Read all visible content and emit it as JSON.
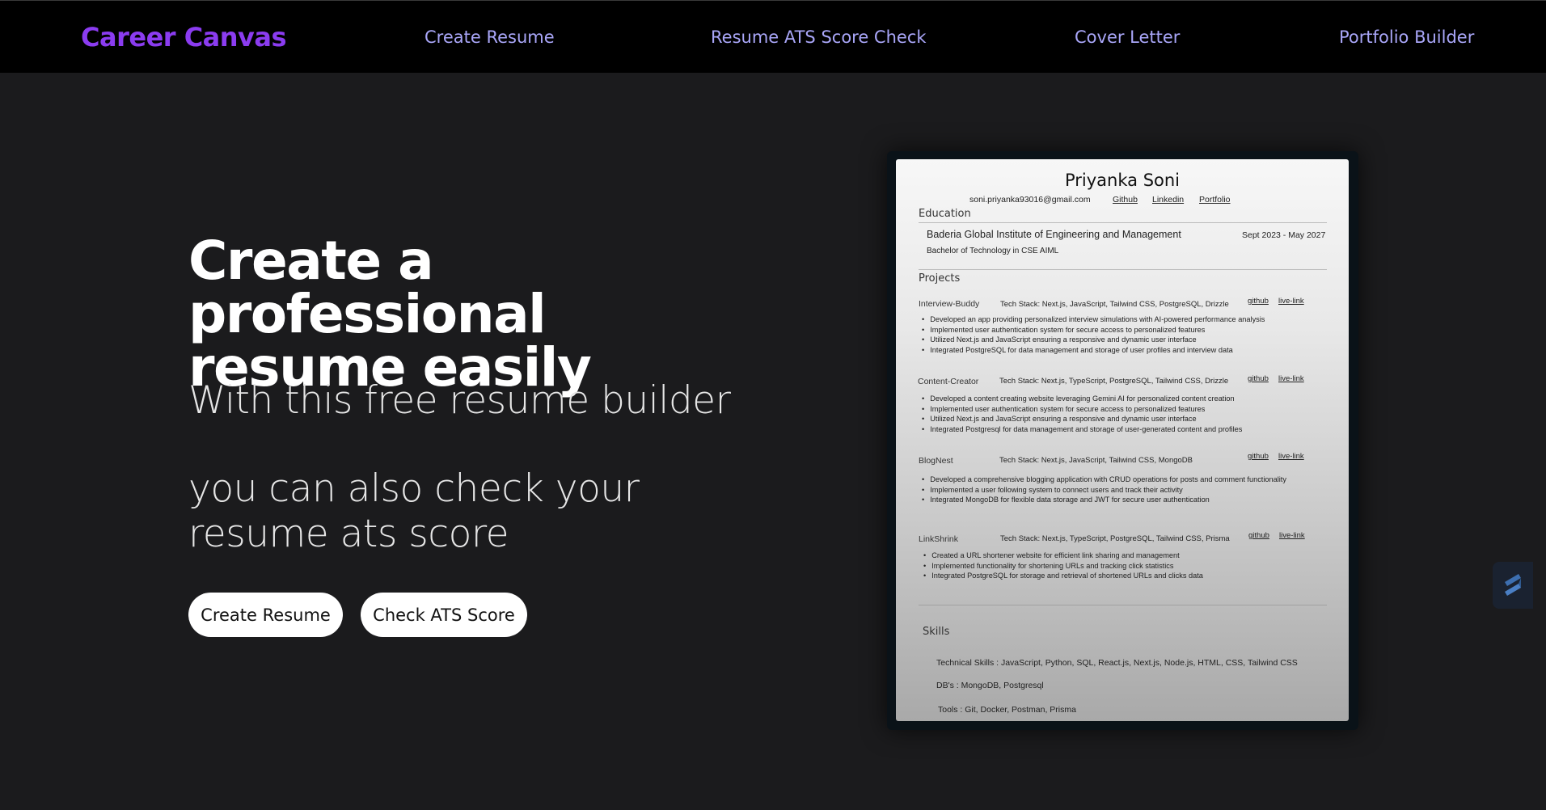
{
  "nav": {
    "brand": "Career Canvas",
    "links": [
      "Create Resume",
      "Resume ATS Score Check",
      "Cover Letter",
      "Portfolio Builder"
    ]
  },
  "hero": {
    "title": "Create a professional resume easily",
    "subtitle": "With this free resume builder",
    "ats_text": "you can also check your resume ats score",
    "buttons": [
      "Create Resume",
      "Check ATS Score"
    ]
  },
  "resume": {
    "name": "Priyanka Soni",
    "email": "soni.priyanka93016@gmail.com",
    "contact_links": [
      "Github",
      "Linkedin",
      "Portfolio"
    ],
    "education_heading": "Education",
    "institute": "Baderia Global Institute of Engineering and Management",
    "dates": "Sept 2023 - May 2027",
    "degree": "Bachelor of Technology in CSE AIML",
    "projects_heading": "Projects",
    "projects": [
      {
        "name": "Interview-Buddy",
        "stack": "Tech Stack: Next.js, JavaScript, Tailwind CSS, PostgreSQL, Drizzle",
        "links": [
          "github",
          "live-link"
        ],
        "bullets": [
          "Developed an app providing personalized interview simulations with AI-powered performance analysis",
          "Implemented user authentication system for secure access to personalized features",
          "Utilized Next.js and JavaScript ensuring a responsive and dynamic user interface",
          "Integrated PostgreSQL for data management and storage of user profiles and interview data"
        ]
      },
      {
        "name": "Content-Creator",
        "stack": "Tech Stack: Next.js, TypeScript, PostgreSQL, Tailwind CSS, Drizzle",
        "links": [
          "github",
          "live-link"
        ],
        "bullets": [
          "Developed a content creating website leveraging Gemini AI for personalized content creation",
          "Implemented user authentication system for secure access to personalized features",
          "Utilized Next.js and JavaScript ensuring a responsive and dynamic user interface",
          "Integrated Postgresql for data management and storage of user-generated content and profiles"
        ]
      },
      {
        "name": "BlogNest",
        "stack": "Tech Stack: Next.js, JavaScript, Tailwind CSS, MongoDB",
        "links": [
          "github",
          "live-link"
        ],
        "bullets": [
          "Developed a comprehensive blogging application with CRUD operations for posts and comment functionality",
          "Implemented a user following system to connect users and track their activity",
          "Integrated MongoDB for flexible data storage and JWT for secure user authentication"
        ]
      },
      {
        "name": "LinkShrink",
        "stack": "Tech Stack: Next.js, TypeScript, PostgreSQL, Tailwind CSS, Prisma",
        "links": [
          "github",
          "live-link"
        ],
        "bullets": [
          "Created a  URL shortener website for efficient link sharing and management",
          "Implemented functionality for shortening URLs and tracking click statistics",
          "Integrated PostgreSQL for storage and retrieval of shortened URLs and clicks data"
        ]
      }
    ],
    "skills_heading": "Skills",
    "skills": [
      "Technical Skills :  JavaScript, Python, SQL, React.js, Next.js, Node.js, HTML, CSS, Tailwind CSS",
      "DB's : MongoDB, Postgresql",
      "Tools : Git, Docker, Postman, Prisma"
    ]
  },
  "colors": {
    "brand": "#8b3cf0",
    "nav_link": "#a9a6f8",
    "background": "#1b1b1d",
    "navbar": "#000000"
  },
  "icons": {
    "floating": "stacked-layers-icon"
  }
}
